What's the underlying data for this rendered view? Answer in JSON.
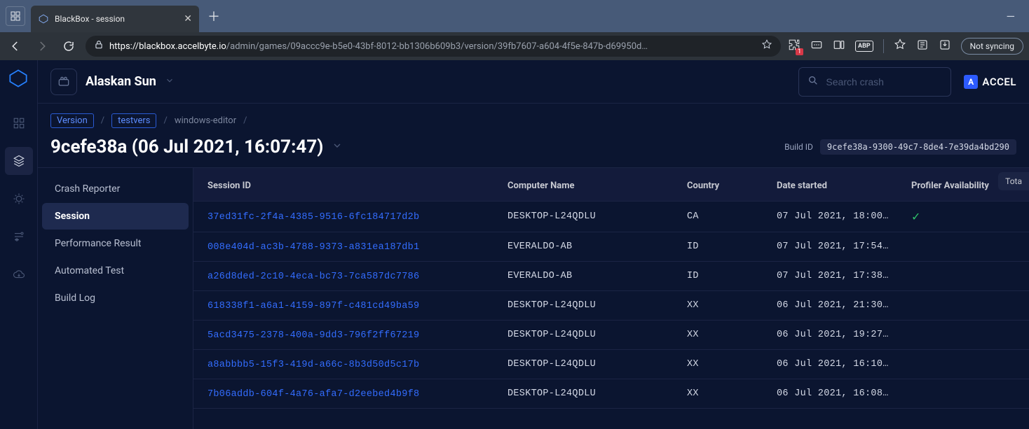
{
  "browser": {
    "tab_title": "BlackBox - session",
    "url_domain": "https://blackbox.accelbyte.io",
    "url_path": "/admin/games/09accc9e-b5e0-43bf-8012-bb1306b609b3/version/39fb7607-a604-4f5e-847b-d69950d…",
    "not_syncing": "Not syncing",
    "badge_count": "1",
    "abp": "ABP"
  },
  "app": {
    "game_name": "Alaskan Sun",
    "search_placeholder": "Search crash",
    "brand_text": "ACCEL"
  },
  "breadcrumb": {
    "version": "Version",
    "testvers": "testvers",
    "platform": "windows-editor"
  },
  "page": {
    "title": "9cefe38a (06 Jul 2021, 16:07:47)",
    "build_id_label": "Build ID",
    "build_id_value": "9cefe38a-9300-49c7-8de4-7e39da4bd290"
  },
  "sidebar": {
    "items": [
      "Crash Reporter",
      "Session",
      "Performance Result",
      "Automated Test",
      "Build Log"
    ],
    "active_index": 1
  },
  "total_label": "Tota",
  "table": {
    "headers": [
      "Session ID",
      "Computer Name",
      "Country",
      "Date started",
      "Profiler Availability"
    ],
    "rows": [
      {
        "id": "37ed31fc-2f4a-4385-9516-6fc184717d2b",
        "computer": "DESKTOP-L24QDLU",
        "country": "CA",
        "date": "07 Jul 2021, 18:00…",
        "profiler": true
      },
      {
        "id": "008e404d-ac3b-4788-9373-a831ea187db1",
        "computer": "EVERALDO-AB",
        "country": "ID",
        "date": "07 Jul 2021, 17:54…",
        "profiler": false
      },
      {
        "id": "a26d8ded-2c10-4eca-bc73-7ca587dc7786",
        "computer": "EVERALDO-AB",
        "country": "ID",
        "date": "07 Jul 2021, 17:38…",
        "profiler": false
      },
      {
        "id": "618338f1-a6a1-4159-897f-c481cd49ba59",
        "computer": "DESKTOP-L24QDLU",
        "country": "XX",
        "date": "06 Jul 2021, 21:30…",
        "profiler": false
      },
      {
        "id": "5acd3475-2378-400a-9dd3-796f2ff67219",
        "computer": "DESKTOP-L24QDLU",
        "country": "XX",
        "date": "06 Jul 2021, 19:27…",
        "profiler": false
      },
      {
        "id": "a8abbbb5-15f3-419d-a66c-8b3d50d5c17b",
        "computer": "DESKTOP-L24QDLU",
        "country": "XX",
        "date": "06 Jul 2021, 16:10…",
        "profiler": false
      },
      {
        "id": "7b06addb-604f-4a76-afa7-d2eebed4b9f8",
        "computer": "DESKTOP-L24QDLU",
        "country": "XX",
        "date": "06 Jul 2021, 16:08…",
        "profiler": false
      }
    ]
  }
}
